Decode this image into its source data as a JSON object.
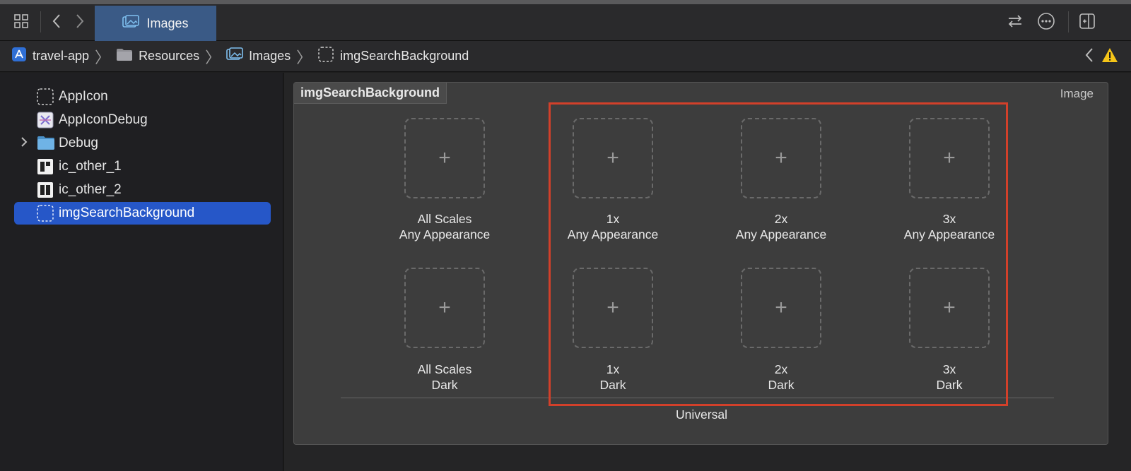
{
  "tabs": [
    {
      "label": "Images",
      "icon": "image-catalog-icon",
      "active": true
    }
  ],
  "toolbar": {
    "left_icons": [
      "grid-icon",
      "chevron-left-icon",
      "chevron-right-icon"
    ],
    "right_icons": [
      "swap-arrows-icon",
      "ellipsis-circle-icon",
      "inspector-toggle-icon"
    ]
  },
  "breadcrumb": {
    "items": [
      {
        "label": "travel-app",
        "icon": "app-project-icon"
      },
      {
        "label": "Resources",
        "icon": "folder-icon"
      },
      {
        "label": "Images",
        "icon": "image-catalog-icon"
      },
      {
        "label": "imgSearchBackground",
        "icon": "image-set-icon"
      }
    ],
    "right_icons": [
      "chevron-left-icon",
      "warning-icon"
    ]
  },
  "sidebar": {
    "items": [
      {
        "label": "AppIcon",
        "icon": "image-set-icon"
      },
      {
        "label": "AppIconDebug",
        "icon": "app-icon-debug-icon"
      },
      {
        "label": "Debug",
        "icon": "folder-icon",
        "disclosure": "chevron-right-icon"
      },
      {
        "label": "ic_other_1",
        "icon": "image-thumbnail-icon"
      },
      {
        "label": "ic_other_2",
        "icon": "image-thumbnail-icon"
      },
      {
        "label": "imgSearchBackground",
        "icon": "image-set-icon",
        "selected": true
      }
    ]
  },
  "editor": {
    "set_name": "imgSearchBackground",
    "set_kind": "Image",
    "slots": [
      {
        "scale": "All Scales",
        "appearance": "Any Appearance"
      },
      {
        "scale": "1x",
        "appearance": "Any Appearance"
      },
      {
        "scale": "2x",
        "appearance": "Any Appearance"
      },
      {
        "scale": "3x",
        "appearance": "Any Appearance"
      },
      {
        "scale": "All Scales",
        "appearance": "Dark"
      },
      {
        "scale": "1x",
        "appearance": "Dark"
      },
      {
        "scale": "2x",
        "appearance": "Dark"
      },
      {
        "scale": "3x",
        "appearance": "Dark"
      }
    ],
    "plus": "+",
    "section_label": "Universal"
  },
  "colors": {
    "accent_selection": "#2657c8",
    "tab_active": "#3a5a86",
    "highlight_box": "#d2402a",
    "warning": "#f5c518"
  }
}
